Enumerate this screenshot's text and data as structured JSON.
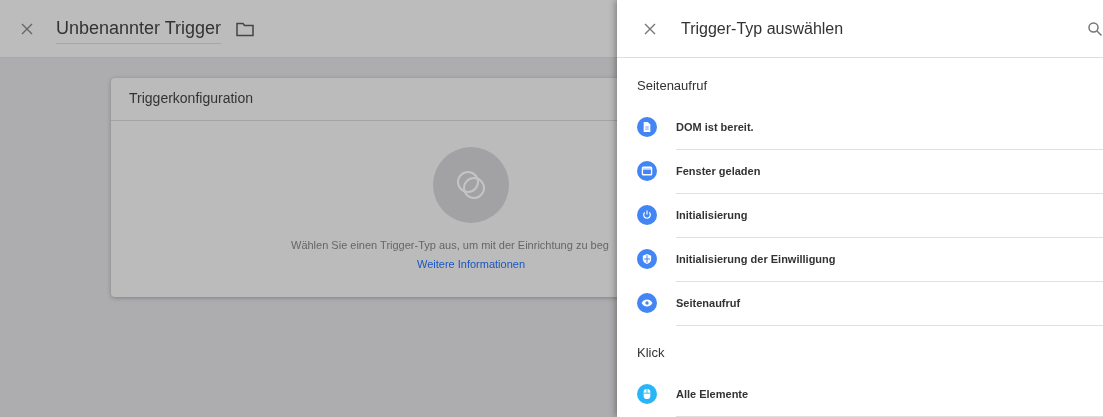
{
  "editor": {
    "title": "Unbenannter Trigger",
    "card": {
      "title": "Triggerkonfiguration",
      "hint": "Wählen Sie einen Trigger-Typ aus, um mit der Einrichtung zu beg",
      "link": "Weitere Informationen"
    }
  },
  "panel": {
    "title": "Trigger-Typ auswählen",
    "sections": [
      {
        "heading": "Seitenaufruf",
        "items": [
          {
            "label": "DOM ist bereit.",
            "kind": "document",
            "color": "#4285f4"
          },
          {
            "label": "Fenster geladen",
            "kind": "window",
            "color": "#4285f4"
          },
          {
            "label": "Initialisierung",
            "kind": "power",
            "color": "#4285f4"
          },
          {
            "label": "Initialisierung der Einwilligung",
            "kind": "shield",
            "color": "#4285f4"
          },
          {
            "label": "Seitenaufruf",
            "kind": "eye",
            "color": "#4285f4"
          }
        ]
      },
      {
        "heading": "Klick",
        "items": [
          {
            "label": "Alle Elemente",
            "kind": "mouse",
            "color": "#29b6f6"
          }
        ]
      }
    ]
  }
}
